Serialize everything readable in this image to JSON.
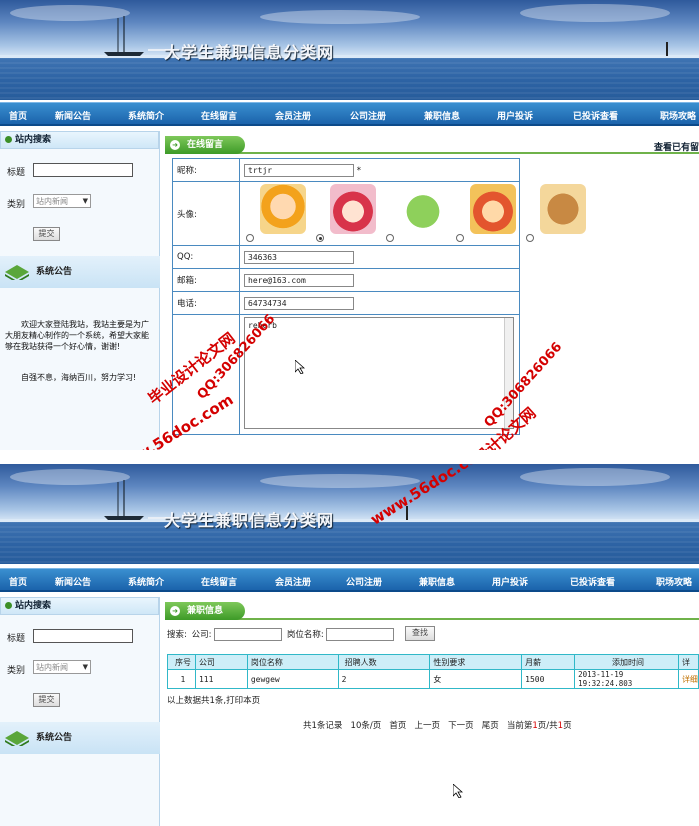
{
  "site_title": "大学生兼职信息分类网",
  "nav": [
    "首页",
    "新闻公告",
    "系统简介",
    "在线留言",
    "会员注册",
    "公司注册",
    "兼职信息",
    "用户投诉",
    "已投诉查看",
    "职场攻略"
  ],
  "sidebar": {
    "search_title": "站内搜索",
    "title_label": "标题",
    "category_label": "类别",
    "category_value": "站内新闻",
    "submit_label": "提交",
    "notice_title": "系统公告",
    "notice_text_1": "欢迎大家登陆我站，我站主要是为广大朋友精心制作的一个系统，希望大家能够在我站获得一个好心情，谢谢!",
    "notice_text_2": "自强不息，海纳百川，努力学习!"
  },
  "screen1": {
    "tab_label": "在线留言",
    "right_link": "查看已有留",
    "form": {
      "nickname_label": "昵称:",
      "nickname_value": "trtjr",
      "required_mark": "*",
      "avatar_label": "头像:",
      "selected_avatar": 2,
      "qq_label": "QQ:",
      "qq_value": "346363",
      "email_label": "邮箱:",
      "email_value": "here@163.com",
      "phone_label": "电话:",
      "phone_value": "64734734",
      "message_value": "reherb"
    }
  },
  "screen2": {
    "tab_label": "兼职信息",
    "search": {
      "label": "搜索:",
      "company_label": "公司:",
      "position_label": "岗位名称:",
      "button": "查找"
    },
    "table": {
      "headers": [
        "序号",
        "公司",
        "岗位名称",
        "招聘人数",
        "性别要求",
        "月薪",
        "添加时间",
        "详"
      ],
      "rows": [
        [
          "1",
          "111",
          "gewgew",
          "2",
          "女",
          "1500",
          "2013-11-19 19:32:24.803",
          "详细"
        ]
      ]
    },
    "summary": "以上数据共1条,打印本页",
    "pager": {
      "total": "共1条记录",
      "per_page": "10条/页",
      "first": "首页",
      "prev": "上一页",
      "next": "下一页",
      "last": "尾页",
      "current_prefix": "当前第",
      "current_page": "1",
      "mid": "页/共",
      "total_pages": "1",
      "suffix": "页"
    }
  },
  "watermarks": {
    "site": "www.56doc.com",
    "qq": "QQ:306826066",
    "name": "毕业设计论文网"
  },
  "colors": {
    "nav": "#1b63ab",
    "green_tab": "#3d9a27",
    "table_border": "#30b8c8",
    "watermark": "#d40000"
  }
}
